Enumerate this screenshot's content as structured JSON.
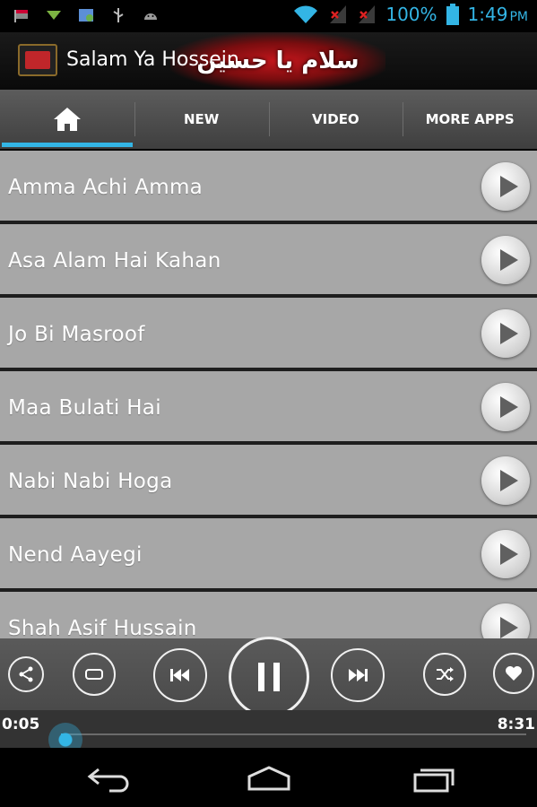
{
  "status_bar": {
    "icons": [
      "flag-icon",
      "download-icon",
      "image-icon",
      "usb-icon",
      "android-icon"
    ],
    "wifi_icon": "wifi-icon",
    "signal_icon": "no-signal-icon",
    "battery_text": "100%",
    "battery_icon": "battery-icon",
    "time": "1:49",
    "ampm": "PM"
  },
  "app_header": {
    "title": "Salam Ya Hossein",
    "banner_text": "سلام یا حسین"
  },
  "tabs": {
    "home_icon": "home-icon",
    "new": "NEW",
    "video": "VIDEO",
    "more_apps": "MORE APPS"
  },
  "songs": [
    {
      "title": "Amma Achi Amma"
    },
    {
      "title": "Asa Alam Hai Kahan"
    },
    {
      "title": "Jo Bi Masroof"
    },
    {
      "title": "Maa Bulati Hai"
    },
    {
      "title": "Nabi Nabi Hoga"
    },
    {
      "title": "Nend Aayegi"
    },
    {
      "title": "Shah Asif Hussain"
    }
  ],
  "player": {
    "controls": [
      "share-icon",
      "repeat-icon",
      "previous-icon",
      "pause-icon",
      "next-icon",
      "shuffle-icon",
      "favorite-icon"
    ],
    "current_time": "0:05",
    "total_time": "8:31",
    "progress": 0.01
  },
  "colors": {
    "accent": "#33b5e5",
    "row_bg": "#a7a7a7",
    "banner_red": "#c4161c"
  }
}
